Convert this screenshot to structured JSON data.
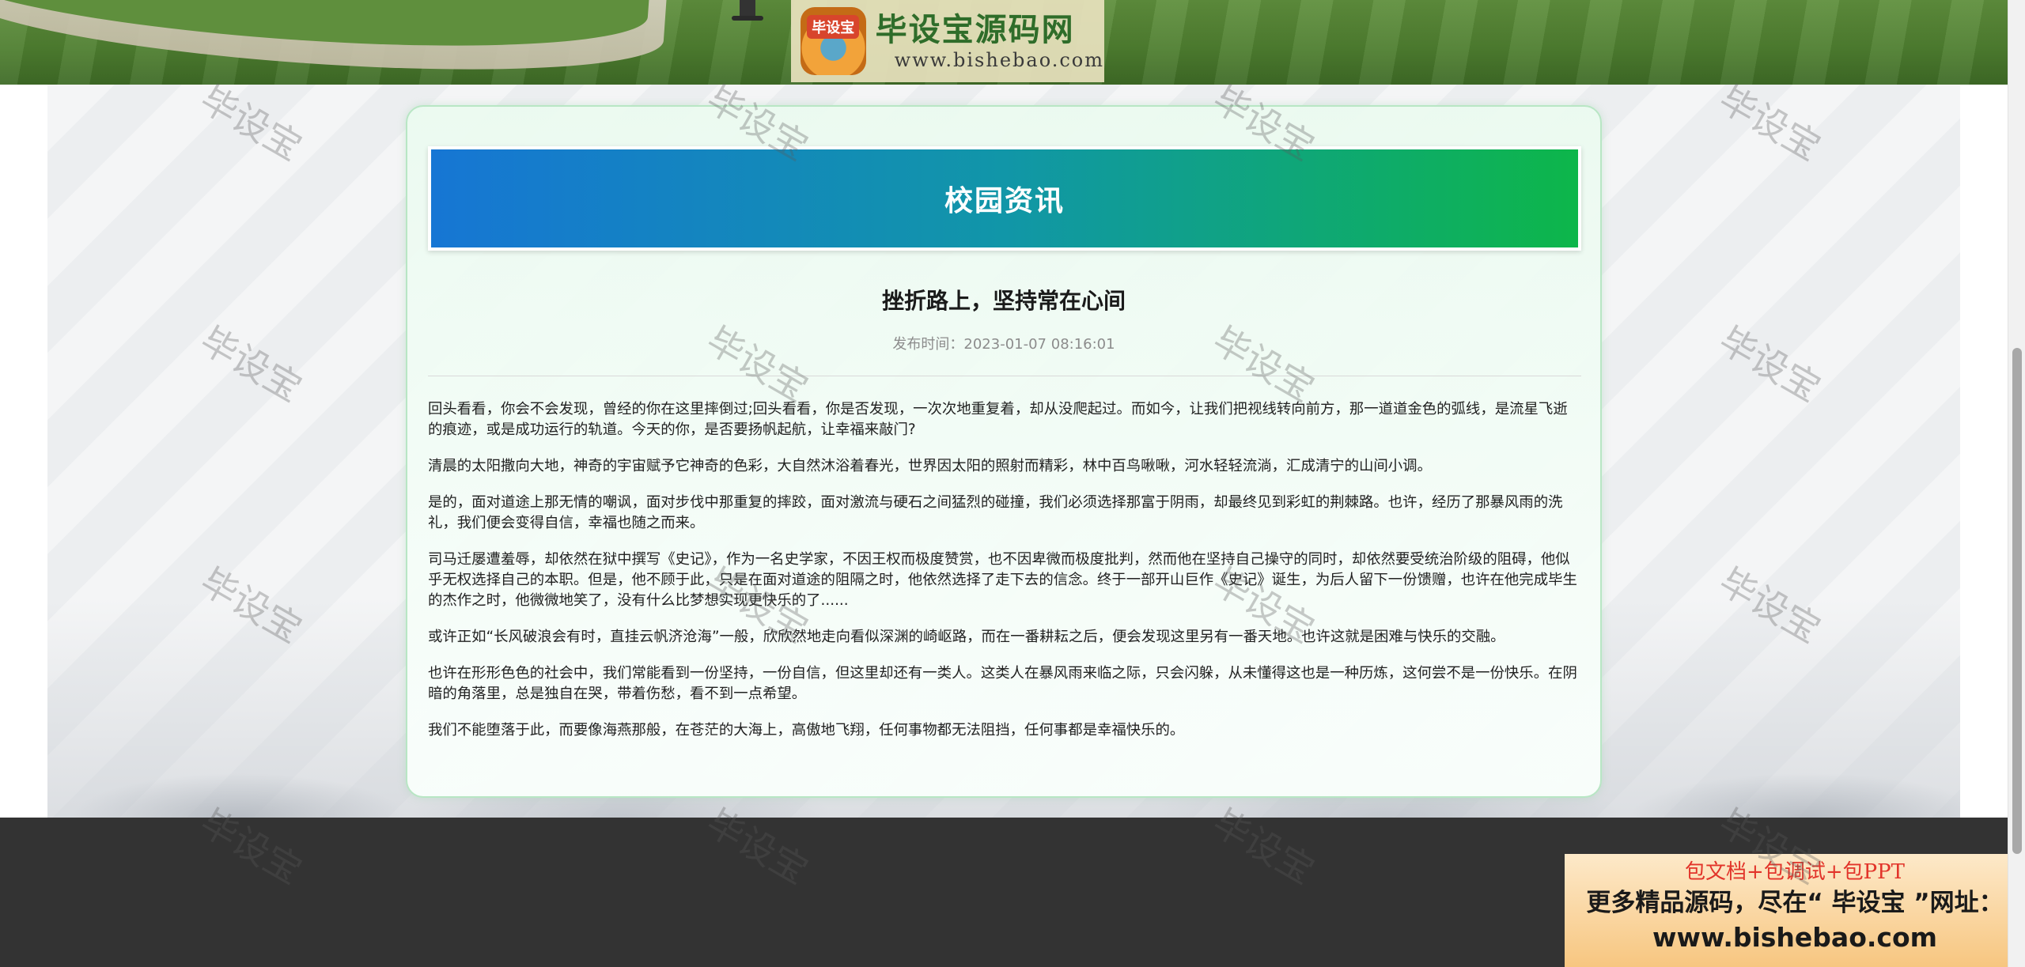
{
  "header": {
    "logo_badge_text": "毕设宝",
    "logo_title": "毕设宝源码网",
    "logo_url": "www.bishebao.com"
  },
  "section": {
    "title": "校园资讯"
  },
  "article": {
    "title": "挫折路上，坚持常在心间",
    "published_label": "发布时间：",
    "published_time": "2023-01-07 08:16:01",
    "paragraphs": [
      "回头看看，你会不会发现，曾经的你在这里摔倒过;回头看看，你是否发现，一次次地重复着，却从没爬起过。而如今，让我们把视线转向前方，那一道道金色的弧线，是流星飞逝的痕迹，或是成功运行的轨道。今天的你，是否要扬帆起航，让幸福来敲门?",
      "清晨的太阳撒向大地，神奇的宇宙赋予它神奇的色彩，大自然沐浴着春光，世界因太阳的照射而精彩，林中百鸟啾啾，河水轻轻流淌，汇成清宁的山间小调。",
      "是的，面对道途上那无情的嘲讽，面对步伐中那重复的摔跤，面对激流与硬石之间猛烈的碰撞，我们必须选择那富于阴雨，却最终见到彩虹的荆棘路。也许，经历了那暴风雨的洗礼，我们便会变得自信，幸福也随之而来。",
      "司马迁屡遭羞辱，却依然在狱中撰写《史记》，作为一名史学家，不因王权而极度赞赏，也不因卑微而极度批判，然而他在坚持自己操守的同时，却依然要受统治阶级的阻碍，他似乎无权选择自己的本职。但是，他不顾于此，只是在面对道途的阻隔之时，他依然选择了走下去的信念。终于一部开山巨作《史记》诞生，为后人留下一份馈赠，也许在他完成毕生的杰作之时，他微微地笑了，没有什么比梦想实现更快乐的了......",
      "或许正如“长风破浪会有时，直挂云帆济沧海”一般，欣欣然地走向看似深渊的崎岖路，而在一番耕耘之后，便会发现这里另有一番天地。也许这就是困难与快乐的交融。",
      "也许在形形色色的社会中，我们常能看到一份坚持，一份自信，但这里却还有一类人。这类人在暴风雨来临之际，只会闪躲，从未懂得这也是一种历炼，这何尝不是一份快乐。在阴暗的角落里，总是独自在哭，带着伤愁，看不到一点希望。",
      "我们不能堕落于此，而要像海燕那般，在苍茫的大海上，高傲地飞翔，任何事物都无法阻挡，任何事都是幸福快乐的。"
    ]
  },
  "promo": {
    "line1": "包文档+包调试+包PPT",
    "line2": "更多精品源码，尽在“ 毕设宝 ”网址：",
    "line3": "www.bishebao.com"
  },
  "watermark": {
    "text": "毕设宝"
  },
  "colors": {
    "header_gradient_start": "#1676d4",
    "header_gradient_end": "#0db64a",
    "card_border": "#b8e6c4",
    "footer_bg": "#333333",
    "promo_red": "#e2342a"
  }
}
